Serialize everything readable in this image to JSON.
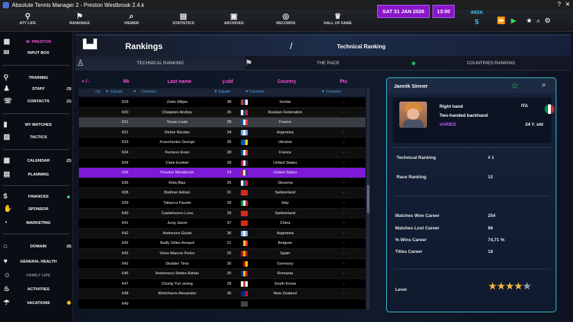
{
  "window": {
    "title": "Absolute Tennis Manager 2  -  Preston Westbrook  2.4.k"
  },
  "topnav": {
    "items": [
      {
        "label": "ATT LIFE",
        "icon": "att-life-icon",
        "glyph": "⚲"
      },
      {
        "label": "RANKINGS",
        "icon": "rankings-icon",
        "glyph": "⚑"
      },
      {
        "label": "VIEWER",
        "icon": "viewer-icon",
        "glyph": "⌕"
      },
      {
        "label": "STATISTICS",
        "icon": "statistics-icon",
        "glyph": "▤"
      },
      {
        "label": "ARCHIVES",
        "icon": "archives-icon",
        "glyph": "▣"
      },
      {
        "label": "RECORDS",
        "icon": "records-icon",
        "glyph": "◎"
      },
      {
        "label": "HALL OF FAME",
        "icon": "hall-of-fame-icon",
        "glyph": "♛"
      }
    ],
    "date": "SAT   31  JAN  2026",
    "time": "13:00",
    "week_label": "WEEK",
    "week_value": "5"
  },
  "sidebar": {
    "user": "W. PRESTON",
    "items": [
      {
        "label": "W. PRESTON",
        "icon": "clipboard-icon",
        "glyph": "▦",
        "count": ""
      },
      {
        "label": "INPUT BOX",
        "icon": "mail-icon",
        "glyph": "✉",
        "count": ""
      },
      {
        "label": "TRAINING",
        "icon": "search-icon",
        "glyph": "⚲",
        "count": ""
      },
      {
        "label": "STAFF",
        "icon": "staff-icon",
        "glyph": "♟",
        "count": "(3)"
      },
      {
        "label": "CONTACTS",
        "icon": "contacts-icon",
        "glyph": "☏",
        "count": "(1)"
      },
      {
        "label": "MY MATCHES",
        "icon": "bar-chart-icon",
        "glyph": "▮",
        "count": ""
      },
      {
        "label": "TACTICS",
        "icon": "tactics-icon",
        "glyph": "▨",
        "count": ""
      },
      {
        "label": "CALENDAR",
        "icon": "calendar-icon",
        "glyph": "▦",
        "count": "(2)"
      },
      {
        "label": "PLANNING",
        "icon": "planning-icon",
        "glyph": "▤",
        "count": ""
      },
      {
        "label": "FINANCES",
        "icon": "dollar-icon",
        "glyph": "$",
        "count": ""
      },
      {
        "label": "SPONSOR",
        "icon": "sponsor-icon",
        "glyph": "✋",
        "count": ""
      },
      {
        "label": "MARKETING",
        "icon": "marketing-icon",
        "glyph": "◔",
        "count": ""
      },
      {
        "label": "DOMAIN",
        "icon": "house-icon",
        "glyph": "⌂",
        "count": "(9)"
      },
      {
        "label": "GENERAL HEALTH",
        "icon": "heart-icon",
        "glyph": "♥",
        "count": ""
      },
      {
        "label": "FAMILY LIFE",
        "icon": "family-icon",
        "glyph": "☺",
        "count": ""
      },
      {
        "label": "ACTIVITIES",
        "icon": "activities-icon",
        "glyph": "♨",
        "count": ""
      },
      {
        "label": "VACATIONS",
        "icon": "vacation-icon",
        "glyph": "☂",
        "count": ""
      }
    ]
  },
  "header": {
    "title": "Rankings",
    "slash": "/",
    "subtitle": "Technical Ranking"
  },
  "tabs": [
    {
      "label": "TECHNICAL RANKING",
      "icon": "tennis-player-icon",
      "glyph": "♙"
    },
    {
      "label": "THE RACE",
      "icon": "flag-icon",
      "glyph": "⚑"
    },
    {
      "label": "COUNTRIES RANKING",
      "icon": "globe-icon",
      "glyph": "●"
    }
  ],
  "table": {
    "plusminus": "+ / -",
    "headers": [
      "Rk",
      "Last name",
      "y.old",
      "Country",
      "Pts"
    ],
    "filter_cp": "Cp",
    "filter_equals": "Equals",
    "filter_contains": "Contains",
    "rows": [
      {
        "rk": "629",
        "name": "Zekic Miljan",
        "age": "38",
        "country": "Serbia",
        "pts": "-",
        "flag": [
          "#c6363c",
          "#0c4076",
          "#ffffff"
        ]
      },
      {
        "rk": "630",
        "name": "Chepelev Andrey",
        "age": "26",
        "country": "Russian Federation",
        "pts": "-",
        "flag": [
          "#ffffff",
          "#0039a6",
          "#d52b1e"
        ]
      },
      {
        "rk": "631",
        "name": "Tessa Louis",
        "age": "28",
        "country": "France",
        "pts": "-",
        "flag": [
          "#0055a4",
          "#ffffff",
          "#ef4135"
        ],
        "style": "gray"
      },
      {
        "rk": "631",
        "name": "Kicker Nicolas",
        "age": "34",
        "country": "Argentina",
        "pts": "-",
        "flag": [
          "#74acdf",
          "#ffffff",
          "#74acdf"
        ]
      },
      {
        "rk": "633",
        "name": "Kravchenko Georgii",
        "age": "26",
        "country": "Ukraine",
        "pts": "-",
        "flag": [
          "#0057b7",
          "#0057b7",
          "#ffd700"
        ]
      },
      {
        "rk": "634",
        "name": "Furness Evan",
        "age": "28",
        "country": "France",
        "pts": "-",
        "flag": [
          "#0055a4",
          "#ffffff",
          "#ef4135"
        ]
      },
      {
        "rk": "634",
        "name": "Clark Ezekiel",
        "age": "28",
        "country": "United States",
        "pts": "-",
        "flag": [
          "#b22234",
          "#ffffff",
          "#3c3b6e"
        ]
      },
      {
        "rk": "636",
        "name": "Preston Westbrook",
        "age": "24",
        "country": "United States",
        "pts": "-",
        "flag": [
          "#b22234",
          "#ffffff",
          "#3c3b6e"
        ],
        "style": "hl"
      },
      {
        "rk": "636",
        "name": "Rola Blaz",
        "age": "26",
        "country": "Slovenia",
        "pts": "-",
        "flag": [
          "#ffffff",
          "#005da4",
          "#ed1c24"
        ]
      },
      {
        "rk": "638",
        "name": "Bodmer Adrian",
        "age": "31",
        "country": "Switzerland",
        "pts": "-",
        "flag": [
          "#d52b1e",
          "#d52b1e",
          "#d52b1e"
        ]
      },
      {
        "rk": "639",
        "name": "Tabacco Fausto",
        "age": "28",
        "country": "Italy",
        "pts": "-",
        "flag": [
          "#009246",
          "#ffffff",
          "#ce2b37"
        ]
      },
      {
        "rk": "640",
        "name": "Castelnuovo Luca",
        "age": "29",
        "country": "Switzerland",
        "pts": "-",
        "flag": [
          "#d52b1e",
          "#d52b1e",
          "#d52b1e"
        ]
      },
      {
        "rk": "641",
        "name": "Jung Jason",
        "age": "37",
        "country": "China",
        "pts": "-",
        "flag": [
          "#de2910",
          "#de2910",
          "#de2910"
        ]
      },
      {
        "rk": "642",
        "name": "Andreozzi Guido",
        "age": "36",
        "country": "Argentina",
        "pts": "-",
        "flag": [
          "#74acdf",
          "#ffffff",
          "#74acdf"
        ]
      },
      {
        "rk": "642",
        "name": "Bailly Gilles Arnaud",
        "age": "21",
        "country": "Belgium",
        "pts": "-",
        "flag": [
          "#000000",
          "#fdda24",
          "#ef3340"
        ]
      },
      {
        "rk": "642",
        "name": "Vives Marcos Pedro",
        "age": "25",
        "country": "Spain",
        "pts": "-",
        "flag": [
          "#aa151b",
          "#f1bf00",
          "#aa151b"
        ]
      },
      {
        "rk": "642",
        "name": "Stodder Timo",
        "age": "30",
        "country": "Germany",
        "pts": "-",
        "flag": [
          "#000000",
          "#dd0000",
          "#ffce00"
        ]
      },
      {
        "rk": "646",
        "name": "Andreescu Stefan Adrian",
        "age": "26",
        "country": "Romania",
        "pts": "-",
        "flag": [
          "#002b7f",
          "#fcd116",
          "#ce1126"
        ]
      },
      {
        "rk": "647",
        "name": "Chung Yun seong",
        "age": "28",
        "country": "South Korea",
        "pts": "-",
        "flag": [
          "#ffffff",
          "#cd2e3a",
          "#ffffff"
        ]
      },
      {
        "rk": "648",
        "name": "Klintcharov Alexander",
        "age": "30",
        "country": "New Zealand",
        "pts": "-",
        "flag": [
          "#00247d",
          "#00247d",
          "#cc142b"
        ]
      },
      {
        "rk": "649",
        "name": "",
        "age": "",
        "country": "",
        "pts": "",
        "flag": [
          "#444",
          "#444",
          "#444"
        ]
      }
    ]
  },
  "player": {
    "name": "Jannik Sinner",
    "hand": "Right hand",
    "backhand": "Two-handed backhand",
    "style": "VARIED",
    "nationality": "ITA",
    "age": "24 Y. old",
    "technical_ranking_label": "Technical Ranking",
    "technical_ranking": "# 1",
    "race_ranking_label": "Race Ranking",
    "race_ranking": "12",
    "matches_won_label": "Matches Won Career",
    "matches_won": "254",
    "matches_lost_label": "Matches Lost Career",
    "matches_lost": "86",
    "win_pct_label": "% Wins Career",
    "win_pct": "74,71 %",
    "titles_label": "Titles Career",
    "titles": "18",
    "level_label": "Level",
    "level_stars": 4,
    "level_max": 5
  }
}
